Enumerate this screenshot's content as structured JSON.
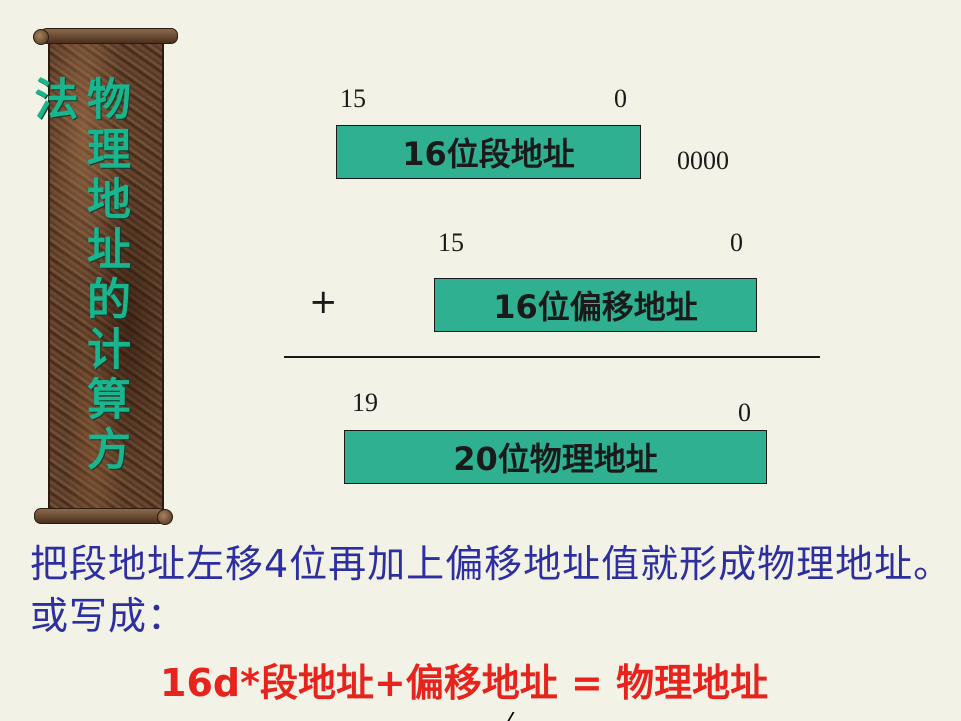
{
  "sidebar": {
    "title": "物理地址的计算方法",
    "colors": {
      "text": "#19b58e",
      "scroll": "#5a3a26"
    }
  },
  "diagram": {
    "segment": {
      "msb": "15",
      "lsb": "0",
      "label": "16位段地址",
      "padding": "0000"
    },
    "offset": {
      "operator": "+",
      "msb": "15",
      "lsb": "0",
      "label": "16位偏移地址"
    },
    "physical": {
      "msb": "19",
      "lsb": "0",
      "label": "20位物理地址"
    },
    "colors": {
      "register": "#2fb091"
    }
  },
  "explanation": {
    "text": "把段地址左移4位再加上偏移地址值就形成物理地址。或写成：",
    "formula": "16d*段地址+偏移地址 = 物理地址",
    "colors": {
      "text": "#2d2ea0",
      "formula": "#e6231c"
    }
  }
}
